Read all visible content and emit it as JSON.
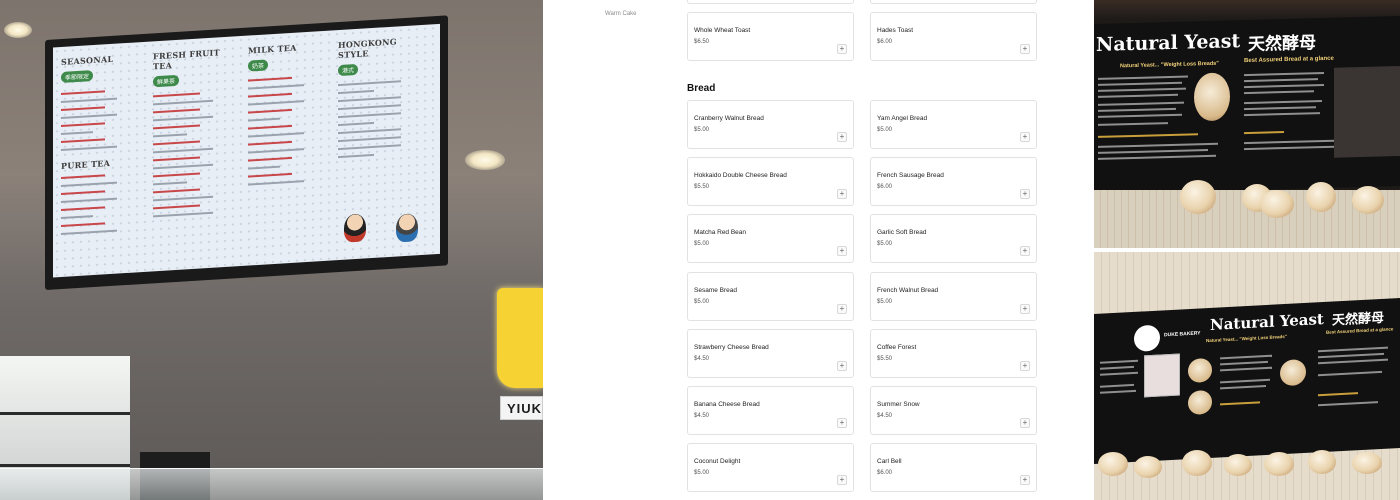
{
  "left_photo": {
    "tv_menu": {
      "sections": [
        "SEASONAL",
        "FRESH FRUIT TEA",
        "MILK TEA",
        "HONGKONG STYLE",
        "PURE TEA"
      ],
      "badges": [
        "季節限定",
        "鮮果茶",
        "奶茶",
        "港式"
      ]
    },
    "store_sign": "YIUK"
  },
  "menu_page": {
    "sidebar_link": "Warm Cake",
    "top_items": [
      {
        "name": "Whole Wheat Toast",
        "price": "$6.50"
      },
      {
        "name": "Hades Toast",
        "price": "$6.00"
      }
    ],
    "section_title": "Bread",
    "items": [
      {
        "name": "Cranberry Walnut Bread",
        "price": "$5.00"
      },
      {
        "name": "Yam Angel Bread",
        "price": "$5.00"
      },
      {
        "name": "Hokkaido Double Cheese Bread",
        "price": "$5.50"
      },
      {
        "name": "French Sausage Bread",
        "price": "$6.00"
      },
      {
        "name": "Matcha Red Bean",
        "price": "$5.00"
      },
      {
        "name": "Garlic Soft Bread",
        "price": "$5.00"
      },
      {
        "name": "Sesame Bread",
        "price": "$5.00"
      },
      {
        "name": "French Walnut Bread",
        "price": "$5.00"
      },
      {
        "name": "Strawberry Cheese Bread",
        "price": "$4.50"
      },
      {
        "name": "Coffee Forest",
        "price": "$5.50"
      },
      {
        "name": "Banana Cheese Bread",
        "price": "$4.50"
      },
      {
        "name": "Summer Snow",
        "price": "$4.50"
      },
      {
        "name": "Coconut Delight",
        "price": "$5.00"
      },
      {
        "name": "Carl Bell",
        "price": "$6.00"
      }
    ],
    "add_label": "+"
  },
  "right_photo_top": {
    "poster_title": "Natural Yeast",
    "poster_title_cn": "天然酵母",
    "poster_subtitle": "Best Assured Bread at a glance",
    "poster_tagline": "Natural Yeast... \"Weight Loss Breads\""
  },
  "right_photo_bottom": {
    "logo_text": "DUKE BAKERY",
    "poster_title": "Natural Yeast",
    "poster_title_cn": "天然酵母",
    "poster_subtitle": "Best Assured Bread at a glance",
    "poster_tagline": "Natural Yeast... \"Weight Loss Breads\""
  },
  "colors": {
    "accent_green": "#3d8a4a",
    "sign_yellow": "#f6d232",
    "poster_gold": "#f3d27a"
  }
}
